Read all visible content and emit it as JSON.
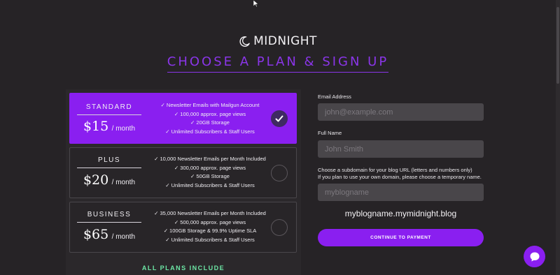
{
  "brand": {
    "name": "MIDNIGHT",
    "icon": "moon-icon"
  },
  "headline": "CHOOSE A PLAN & SIGN UP",
  "plans": [
    {
      "name": "STANDARD",
      "price": "$15",
      "unit": "/ month",
      "selected": true,
      "features": [
        "✓ Newsletter Emails with Mailgun Account",
        "✓ 100,000 approx. page views",
        "✓ 20GB Storage",
        "✓ Unlimited Subscribers & Staff Users"
      ]
    },
    {
      "name": "PLUS",
      "price": "$20",
      "unit": "/ month",
      "selected": false,
      "features": [
        "✓ 10,000 Newsletter Emails per Month Included",
        "✓ 300,000 approx. page views",
        "✓ 50GB Storage",
        "✓ Unlimited Subscribers & Staff Users"
      ]
    },
    {
      "name": "BUSINESS",
      "price": "$65",
      "unit": "/ month",
      "selected": false,
      "features": [
        "✓ 35,000 Newsletter Emails per Month Included",
        "✓ 500,000 approx. page views",
        "✓ 100GB Storage & 99.9% Uptime SLA",
        "✓ Unlimited Subscribers & Staff Users"
      ]
    }
  ],
  "all_plans_include": "ALL PLANS INCLUDE",
  "form": {
    "email_label": "Email Address",
    "email_placeholder": "john@example.com",
    "name_label": "Full Name",
    "name_placeholder": "John Smith",
    "subdomain_label_1": "Choose a subdomain for your blog URL (letters and numbers only)",
    "subdomain_label_2": "If you plan to use your own domain, please choose a temporary name.",
    "subdomain_placeholder": "myblogname",
    "url_preview": "myblogname.mymidnight.blog",
    "submit_label": "CONTINUE TO PAYMENT"
  },
  "colors": {
    "accent": "#8a1ff0",
    "highlight": "#6de8a6",
    "background": "#262326"
  }
}
